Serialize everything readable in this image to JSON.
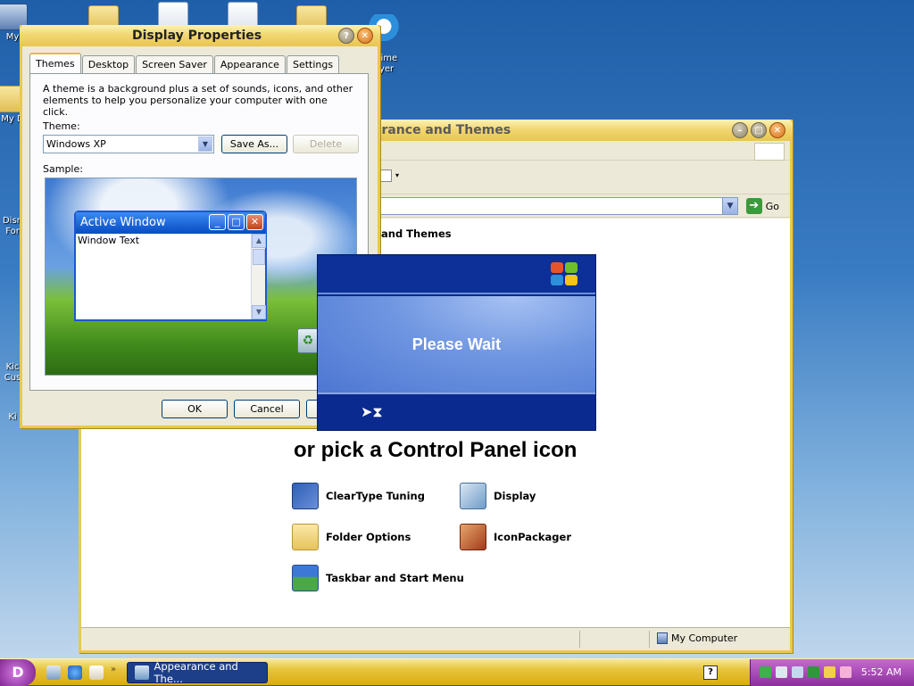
{
  "desktop": {
    "icons": [
      {
        "label": "My"
      },
      {
        "label": "My D"
      },
      {
        "label": "Disn\nFor"
      },
      {
        "label": "Kic\nCus"
      },
      {
        "label": "Ki"
      },
      {
        "label": "kTime\nayer"
      }
    ]
  },
  "control_panel": {
    "title": "arance and Themes",
    "heading_small": "and Themes",
    "heading_big": "or pick a Control Panel icon",
    "go_label": "Go",
    "items": [
      {
        "label": "ClearType Tuning",
        "icon": "cleartype-icon"
      },
      {
        "label": "Display",
        "icon": "display-icon"
      },
      {
        "label": "Folder Options",
        "icon": "folder-options-icon"
      },
      {
        "label": "IconPackager",
        "icon": "iconpackager-icon"
      },
      {
        "label": "Taskbar and Start Menu",
        "icon": "taskbar-icon"
      }
    ],
    "status_location": "My Computer"
  },
  "display_properties": {
    "title": "Display Properties",
    "tabs": [
      "Themes",
      "Desktop",
      "Screen Saver",
      "Appearance",
      "Settings"
    ],
    "active_tab": "Themes",
    "description": "A theme is a background plus a set of sounds, icons, and other elements to help you personalize your computer with one click.",
    "theme_label": "Theme:",
    "theme_value": "Windows XP",
    "save_as_label": "Save As...",
    "delete_label": "Delete",
    "sample_label": "Sample:",
    "sample_window_title": "Active Window",
    "sample_window_text": "Window Text",
    "ok_label": "OK",
    "cancel_label": "Cancel"
  },
  "please_wait": {
    "text": "Please Wait"
  },
  "taskbar": {
    "task_label": "Appearance and The...",
    "clock": "5:52 AM"
  },
  "colors": {
    "title_gold": "#e8c552",
    "wait_blue": "#0a2a8f",
    "tray_purple": "#8c2f9d"
  }
}
